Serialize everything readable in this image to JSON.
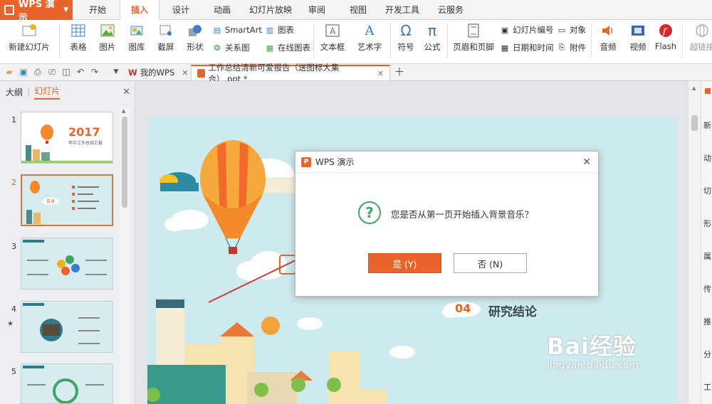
{
  "app": {
    "name": "WPS 演示"
  },
  "menu": {
    "tabs": [
      "开始",
      "插入",
      "设计",
      "动画",
      "幻灯片放映",
      "审阅",
      "视图",
      "开发工具",
      "云服务"
    ],
    "active": "插入"
  },
  "ribbon": {
    "new_slide": "新建幻灯片",
    "table": "表格",
    "image": "图片",
    "gallery": "图库",
    "screenshot": "截屏",
    "shape": "形状",
    "smartart": "SmartArt",
    "chart": "图表",
    "relation": "关系图",
    "online_chart": "在线图表",
    "textbox": "文本框",
    "wordart": "艺术字",
    "symbol": "符号",
    "formula": "公式",
    "header_footer": "页眉和页脚",
    "slide_number": "幻灯片编号",
    "object": "对象",
    "datetime": "日期和时间",
    "attachment": "附件",
    "audio": "音频",
    "video": "视频",
    "flash": "Flash",
    "hyperlink": "超链接"
  },
  "doc_tabs": [
    {
      "label": "我的WPS"
    },
    {
      "label": "工作总结清新可爱报告（送图标大集合）.ppt *"
    }
  ],
  "left_panel": {
    "outline": "大纲",
    "slides": "幻灯片",
    "thumbs": [
      "1",
      "2",
      "3",
      "4",
      "5"
    ]
  },
  "slide": {
    "thumb1_year": "2017",
    "thumb1_title": "年中工作总结汇报",
    "thumb2_label": "目录",
    "section_num": "04",
    "section_title": "研究结论"
  },
  "sidebar": [
    "新",
    "动",
    "切",
    "形",
    "属",
    "传",
    "推",
    "分",
    "工"
  ],
  "dialog": {
    "title": "WPS 演示",
    "message": "您是否从第一页开始插入背景音乐？",
    "yes": "是 (Y)",
    "no": "否 (N)"
  },
  "watermark": {
    "brand": "Bai经验",
    "url": "jingyan.baidu.com"
  },
  "colors": {
    "accent": "#e8642c",
    "slide_bg": "#cdeaee",
    "confirm_green": "#3ea56a"
  }
}
